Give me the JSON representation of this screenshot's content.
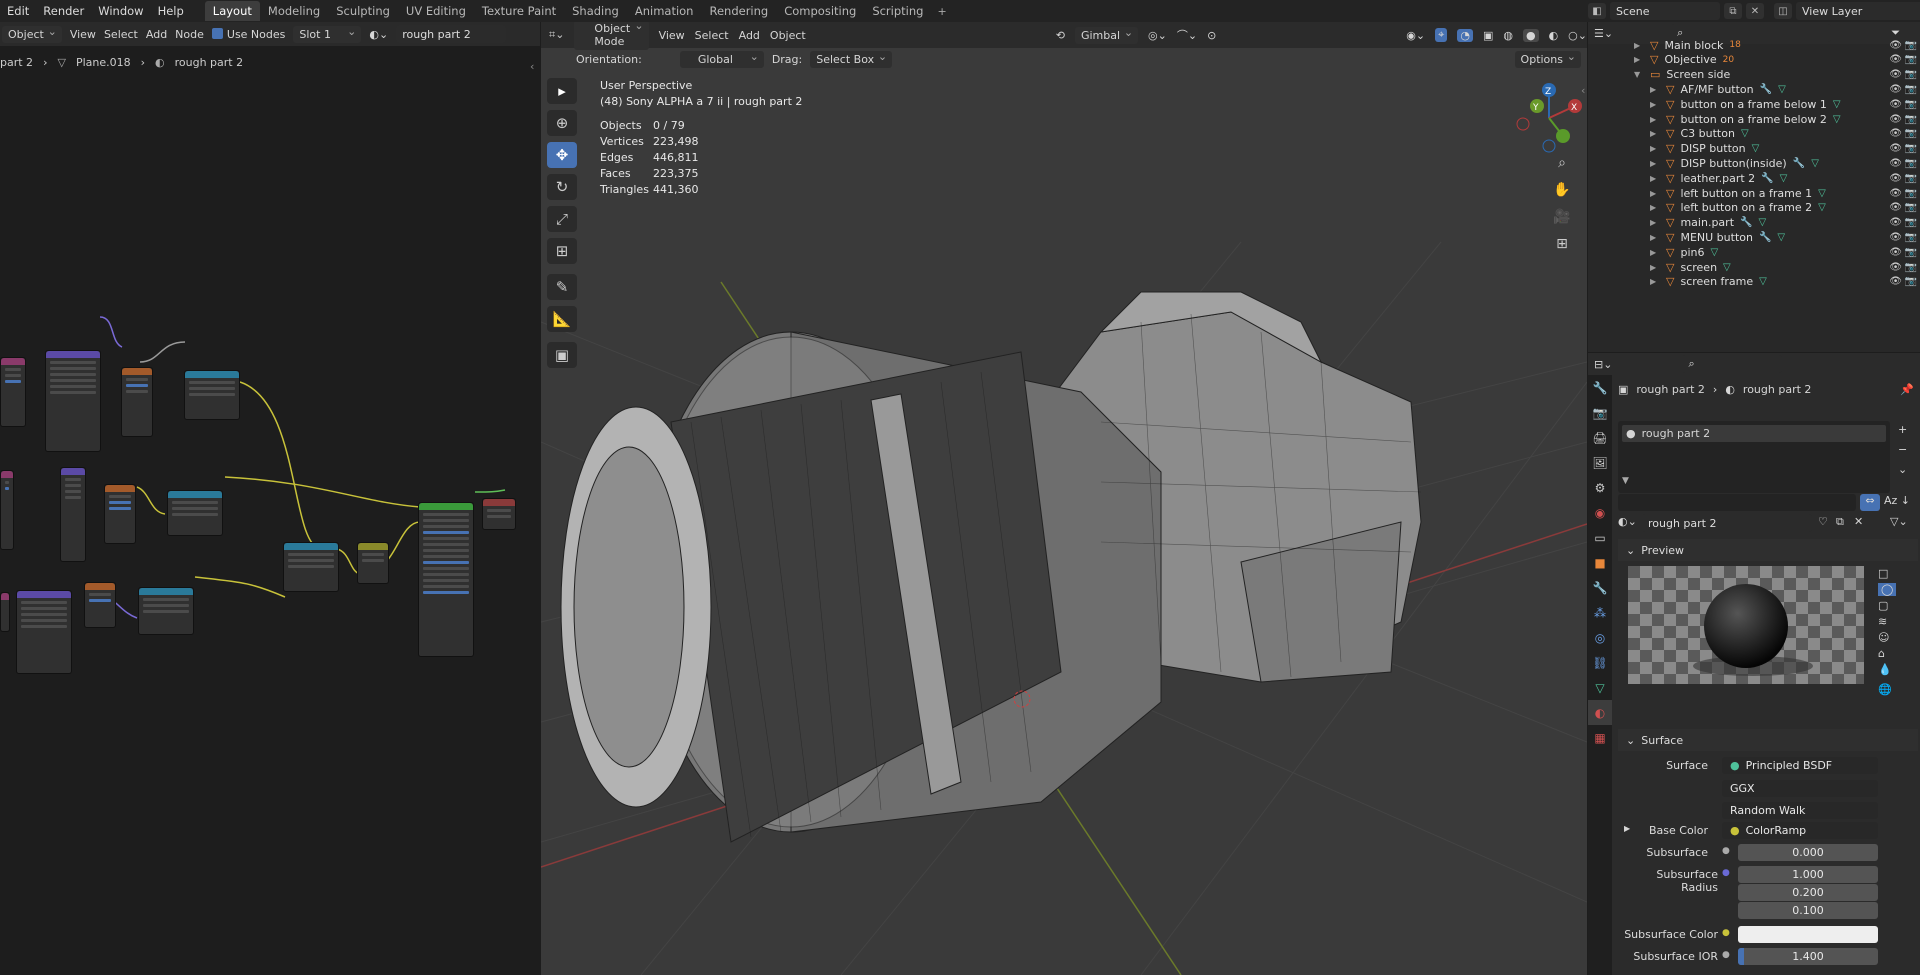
{
  "topbar": {
    "menus": [
      "Edit",
      "Render",
      "Window",
      "Help"
    ],
    "workspaces": [
      "Layout",
      "Modeling",
      "Sculpting",
      "UV Editing",
      "Texture Paint",
      "Shading",
      "Animation",
      "Rendering",
      "Compositing",
      "Scripting"
    ],
    "scene": "Scene",
    "view_layer": "View Layer"
  },
  "node_editor": {
    "object_dd": "Object",
    "menus": [
      "View",
      "Select",
      "Add",
      "Node"
    ],
    "use_nodes": "Use Nodes",
    "slot": "Slot 1",
    "material": "rough part 2",
    "breadcrumb": [
      "part 2",
      "Plane.018",
      "rough part 2"
    ]
  },
  "viewport": {
    "mode": "Object Mode",
    "menus": [
      "View",
      "Select",
      "Add",
      "Object"
    ],
    "transform": "Gimbal",
    "orientation_label": "Orientation:",
    "orientation": "Global",
    "drag_label": "Drag:",
    "drag": "Select Box",
    "options": "Options",
    "perspective": "User Perspective",
    "object_line": "(48) Sony ALPHA a 7 ii | rough part 2",
    "stats": [
      [
        "Objects",
        "0 / 79"
      ],
      [
        "Vertices",
        "223,498"
      ],
      [
        "Edges",
        "446,811"
      ],
      [
        "Faces",
        "223,375"
      ],
      [
        "Triangles",
        "441,360"
      ]
    ],
    "gizmo": {
      "z": "Z",
      "y": "Y",
      "x": "X"
    }
  },
  "outliner": {
    "items": [
      {
        "name": "Main block",
        "depth": 1,
        "extra": "18",
        "mod": false,
        "dat": false
      },
      {
        "name": "Objective",
        "depth": 1,
        "extra": "20",
        "mod": false,
        "dat": false
      },
      {
        "name": "Screen side",
        "depth": 1,
        "expanded": true,
        "mod": false,
        "dat": false
      },
      {
        "name": "AF/MF button",
        "depth": 2,
        "mod": true,
        "dat": true
      },
      {
        "name": "button on a frame below 1",
        "depth": 2,
        "mod": false,
        "dat": true
      },
      {
        "name": "button on a frame below 2",
        "depth": 2,
        "mod": false,
        "dat": true
      },
      {
        "name": "C3 button",
        "depth": 2,
        "mod": false,
        "dat": true
      },
      {
        "name": "DISP button",
        "depth": 2,
        "mod": false,
        "dat": true
      },
      {
        "name": "DISP button(inside)",
        "depth": 2,
        "mod": true,
        "dat": true
      },
      {
        "name": "leather.part 2",
        "depth": 2,
        "mod": true,
        "dat": true
      },
      {
        "name": "left button on a frame 1",
        "depth": 2,
        "mod": false,
        "dat": true
      },
      {
        "name": "left button on a frame 2",
        "depth": 2,
        "mod": false,
        "dat": true
      },
      {
        "name": "main.part",
        "depth": 2,
        "mod": true,
        "dat": true
      },
      {
        "name": "MENU button",
        "depth": 2,
        "mod": true,
        "dat": true
      },
      {
        "name": "pin6",
        "depth": 2,
        "mod": false,
        "dat": true
      },
      {
        "name": "screen",
        "depth": 2,
        "mod": false,
        "dat": true
      },
      {
        "name": "screen frame",
        "depth": 2,
        "mod": false,
        "dat": true
      }
    ]
  },
  "properties": {
    "breadcrumb": [
      "rough part 2",
      "rough part 2"
    ],
    "slot": "rough part 2",
    "material": "rough part 2",
    "preview": "Preview",
    "surface_panel": "Surface",
    "fields": {
      "surface_label": "Surface",
      "surface": "Principled BSDF",
      "dist": "GGX",
      "sss_method": "Random Walk",
      "base_color_label": "Base Color",
      "base_color": "ColorRamp",
      "subsurface_label": "Subsurface",
      "subsurface": "0.000",
      "radius_label": "Subsurface Radius",
      "radius": [
        "1.000",
        "0.200",
        "0.100"
      ],
      "sss_color_label": "Subsurface Color",
      "sss_ior_label": "Subsurface IOR",
      "sss_ior": "1.400",
      "sss_ior_fraction": 0.04
    }
  }
}
